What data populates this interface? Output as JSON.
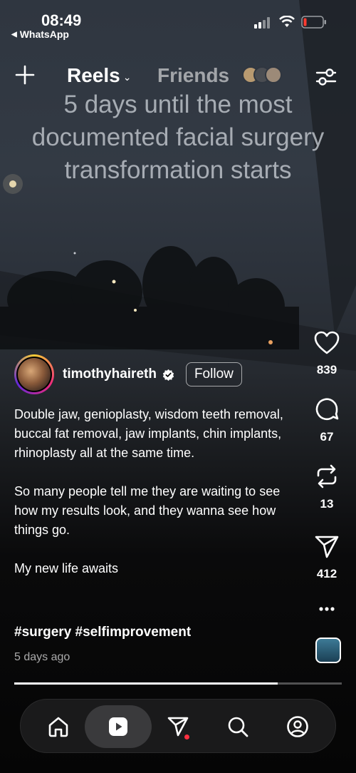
{
  "status_bar": {
    "time": "08:49",
    "back_app": "WhatsApp"
  },
  "top_nav": {
    "tab_reels": "Reels",
    "tab_friends": "Friends"
  },
  "video_overlay_text": "5 days until the most documented facial surgery transformation starts",
  "author": {
    "username": "timothyhaireth",
    "follow_label": "Follow"
  },
  "caption": {
    "paragraphs": [
      "Double jaw, genioplasty, wisdom teeth removal, buccal fat removal, jaw implants, chin implants, rhinoplasty all at the same time.",
      "So many people tell me they are waiting to see how my results look, and they wanna see how things go.",
      "My new life awaits"
    ],
    "hashtags": "#surgery #selfimprovement",
    "time_ago": "5 days ago"
  },
  "actions": {
    "likes": "839",
    "comments": "67",
    "reposts": "13",
    "shares": "412"
  },
  "playback_progress": 0.805,
  "colors": {
    "accent_red": "#ff3040",
    "active_nav_bg": "#3a3a3c"
  },
  "icons": [
    "plus-icon",
    "chevron-down-icon",
    "filter-sliders-icon",
    "heart-icon",
    "comment-icon",
    "repost-icon",
    "share-icon",
    "more-icon",
    "home-icon",
    "reels-icon",
    "messages-icon",
    "search-icon",
    "profile-icon"
  ]
}
